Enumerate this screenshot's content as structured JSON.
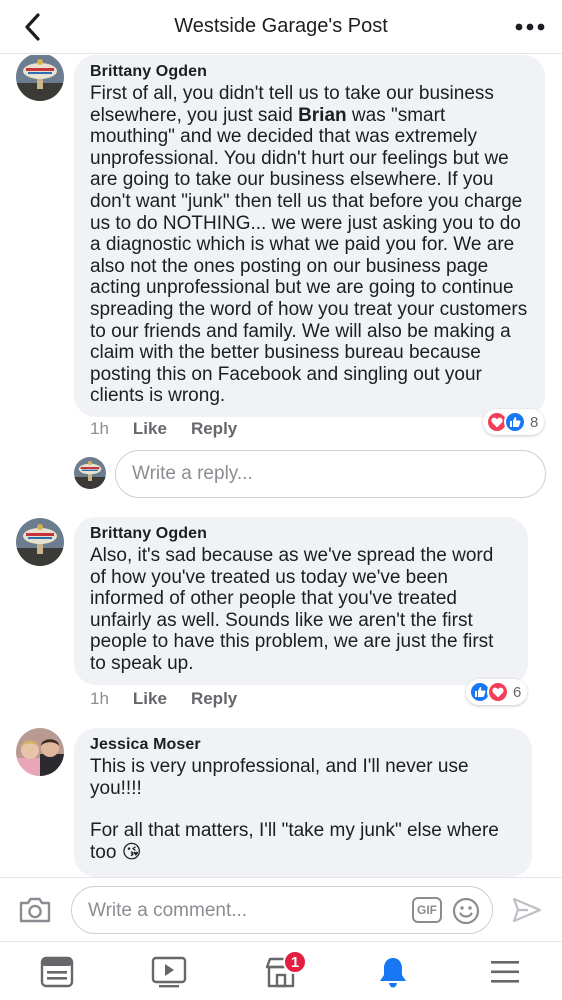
{
  "header": {
    "title": "Westside Garage's Post",
    "back_icon": "chevron-left-icon",
    "more_icon": "more-dots-icon"
  },
  "comments": [
    {
      "author": "Brittany Ogden",
      "text_before": "First of all, you didn't tell us to take our business elsewhere, you just said ",
      "text_bold": "Brian",
      "text_after": " was \"smart mouthing\" and we decided that was extremely unprofessional. You didn't hurt our feelings but we are going to take our business elsewhere. If you don't want \"junk\" then tell us that before you charge us to do NOTHING... we were just asking you to do a diagnostic which is what we paid you for. We are also not the ones posting on our business page acting unprofessional but we are going to continue spreading the word of how you treat your customers to our friends and family. We will also be making a claim with the better business bureau because posting this on Facebook and singling out your clients is wrong.",
      "time": "1h",
      "like_label": "Like",
      "reply_label": "Reply",
      "reaction_count": "8"
    },
    {
      "author": "Brittany Ogden",
      "text": "Also, it's sad because as we've spread the word of how you've treated us today we've been informed of other people that you've treated unfairly as well. Sounds like we aren't the first people to have this problem, we are just the first to speak up.",
      "time": "1h",
      "like_label": "Like",
      "reply_label": "Reply",
      "reaction_count": "6"
    },
    {
      "author": "Jessica Moser",
      "text_line1": "This is very unprofessional, and I'll never use you!!!!",
      "text_line2": "For all that matters, I'll \"take my junk\" else where too 😘"
    }
  ],
  "reply_box": {
    "placeholder": "Write a reply..."
  },
  "composer": {
    "placeholder": "Write a comment...",
    "gif_label": "GIF"
  },
  "bottom_nav": {
    "marketplace_badge": "1"
  },
  "colors": {
    "accent": "#1877f2",
    "love": "#f33e58",
    "badge": "#e41e3f",
    "bubble": "#f0f2f5"
  }
}
